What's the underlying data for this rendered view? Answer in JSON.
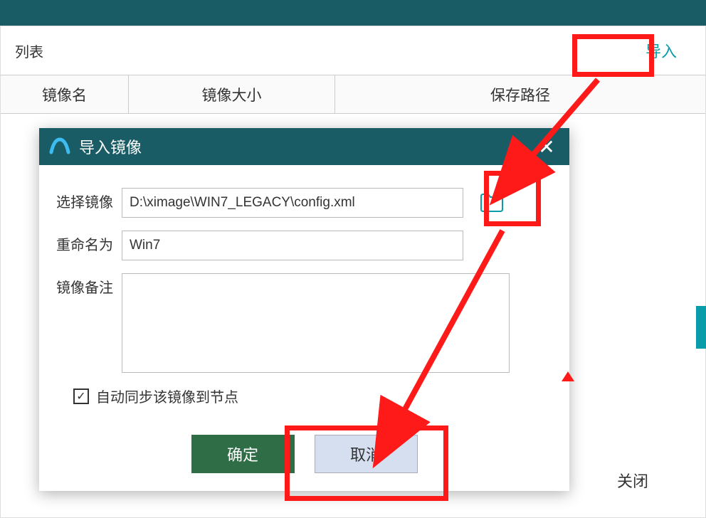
{
  "list": {
    "title_suffix": "列表",
    "import_label": "导入",
    "columns": {
      "name": "镜像名",
      "size": "镜像大小",
      "path": "保存路径"
    }
  },
  "dialog": {
    "title": "导入镜像",
    "labels": {
      "select": "选择镜像",
      "rename": "重命名为",
      "note": "镜像备注"
    },
    "values": {
      "path": "D:\\ximage\\WIN7_LEGACY\\config.xml",
      "rename": "Win7",
      "note": ""
    },
    "checkbox": {
      "checked": true,
      "label": "自动同步该镜像到节点"
    },
    "buttons": {
      "ok": "确定",
      "cancel": "取消"
    }
  },
  "bottom": {
    "close_label": "关闭"
  },
  "colors": {
    "accent": "#1a5c66",
    "primary_btn": "#2e6d45",
    "highlight": "#ff1a1a"
  }
}
